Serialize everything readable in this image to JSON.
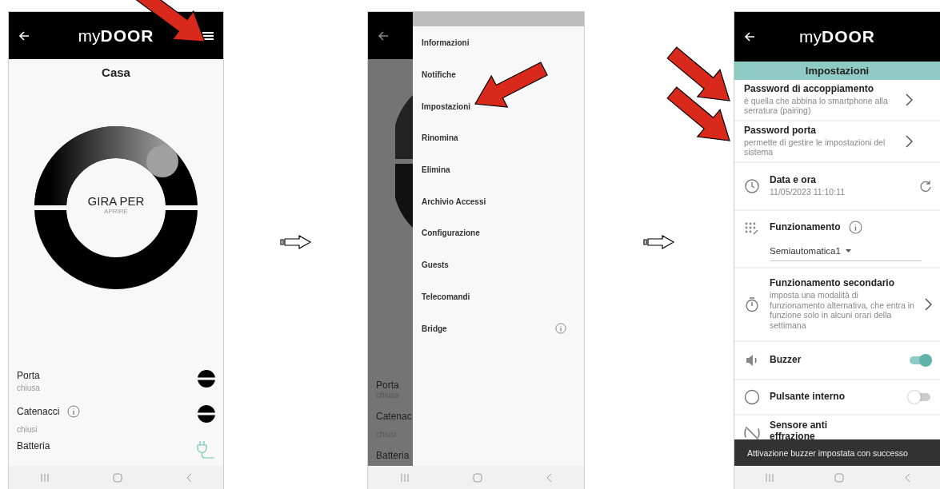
{
  "home_screen": {
    "logo": {
      "light": "my",
      "bold": "DOOR"
    },
    "title": "Casa",
    "dial": {
      "label": "GIRA PER",
      "sublabel": "APRIRE"
    },
    "status": [
      {
        "kind": "lock",
        "label": "Porta",
        "value": "chiusa",
        "info": false
      },
      {
        "kind": "lock",
        "label": "Catenacci",
        "value": "chiusi",
        "info": true
      },
      {
        "kind": "plug",
        "label": "Batteria",
        "info": false
      }
    ]
  },
  "menu_screen": {
    "background_texts": [
      {
        "label": "Porta",
        "value": "chiusa"
      },
      {
        "label": "Catenac",
        "value": "chiusi"
      },
      {
        "label": "Batteria"
      }
    ],
    "items": [
      {
        "label": "Informazioni",
        "info": false
      },
      {
        "label": "Notifiche",
        "info": false
      },
      {
        "label": "Impostazioni",
        "info": false
      },
      {
        "label": "Rinomina",
        "info": false
      },
      {
        "label": "Elimina",
        "info": false
      },
      {
        "label": "Archivio Accessi",
        "info": false
      },
      {
        "label": "Configurazione",
        "info": false
      },
      {
        "label": "Guests",
        "info": false
      },
      {
        "label": "Telecomandi",
        "info": false
      },
      {
        "label": "Bridge",
        "info": true
      }
    ]
  },
  "settings_screen": {
    "logo": {
      "light": "my",
      "bold": "DOOR"
    },
    "title": "Impostazioni",
    "rows": [
      {
        "kind": "link",
        "title": "Password di accoppiamento",
        "description": "è quella che abbina lo smartphone alla serratura (pairing)"
      },
      {
        "kind": "link",
        "title": "Password porta",
        "description": "permette di gestire le impostazioni del sistema"
      },
      {
        "kind": "datetime",
        "title": "Data e ora",
        "value": "11/05/2023 11:10:11"
      },
      {
        "kind": "select",
        "title": "Funzionamento",
        "value": "Semiautomatica1"
      },
      {
        "kind": "link",
        "title": "Funzionamento secondario",
        "description": "imposta una modalità di funzionamento alternativa, che entra in funzione solo in alcuni orari della settimana"
      },
      {
        "kind": "toggle",
        "title": "Buzzer",
        "on": true
      },
      {
        "kind": "toggle",
        "title": "Pulsante interno",
        "on": false
      },
      {
        "kind": "cut",
        "title": "Sensore anti effrazione"
      }
    ],
    "snackbar": "Attivazione buzzer impostata con successo"
  }
}
